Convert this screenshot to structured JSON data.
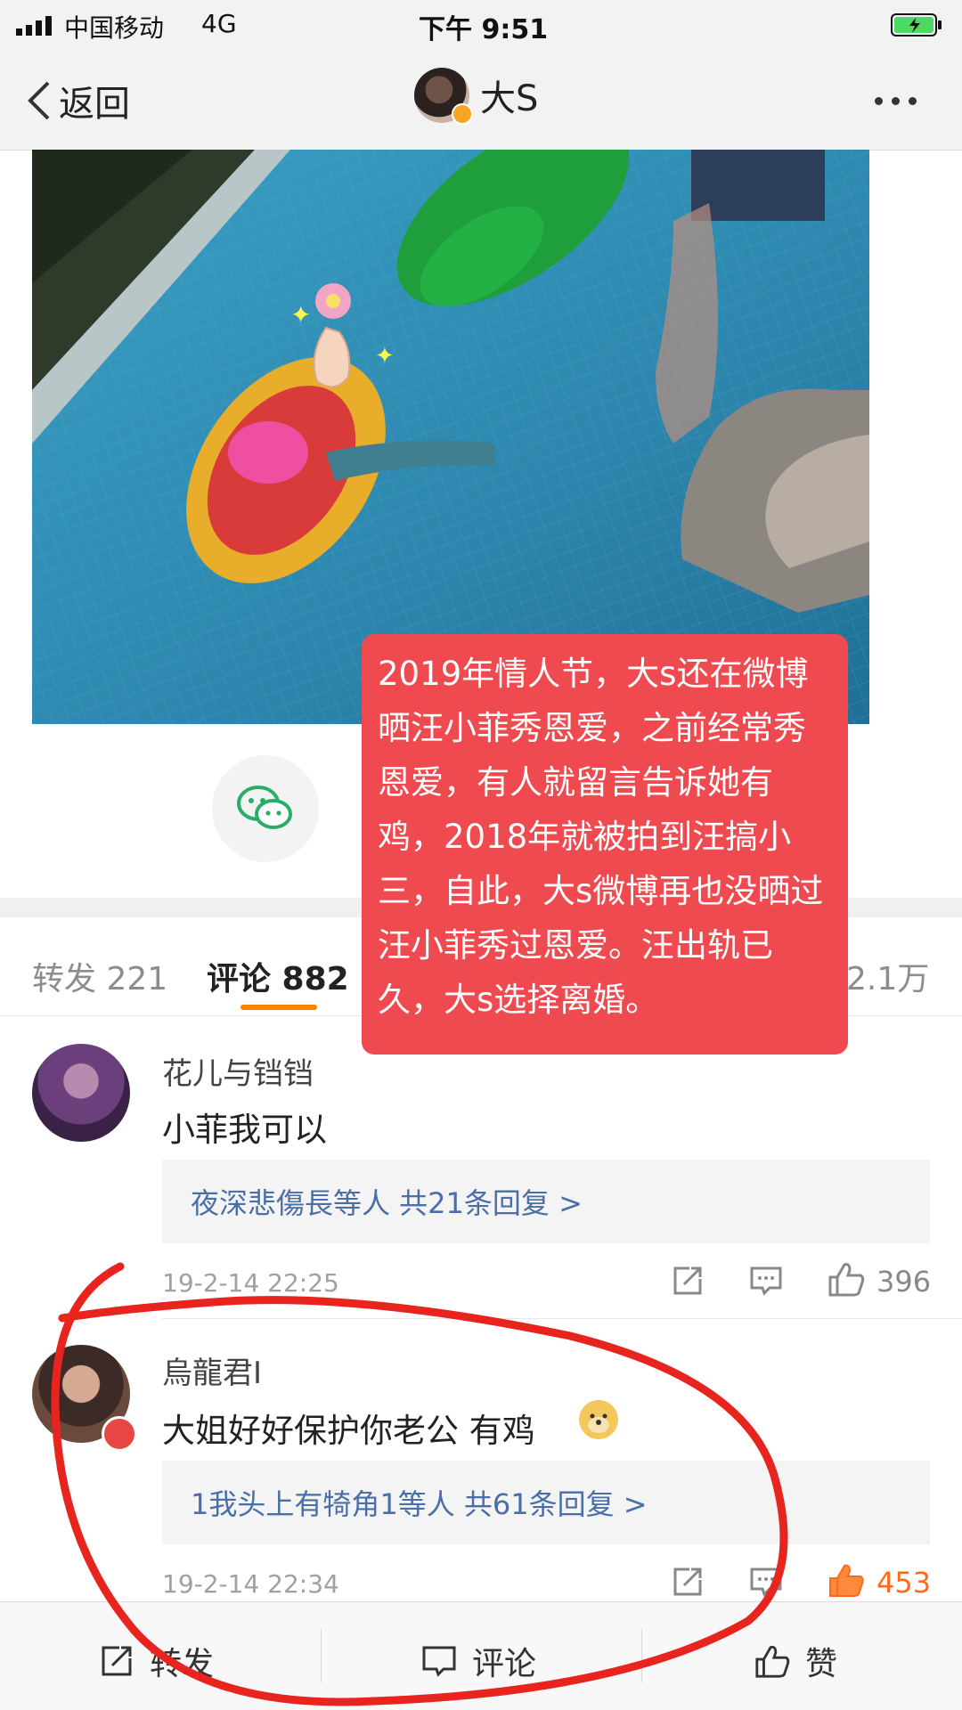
{
  "status_bar": {
    "carrier": "中国移动",
    "network": "4G",
    "time": "下午 9:51",
    "battery_color": "#4cd964"
  },
  "nav": {
    "back_label": "返回",
    "username": "大S",
    "more_icon": "more-dots-icon"
  },
  "annotation": {
    "text": "2019年情人节，大s还在微博晒汪小菲秀恩爱，之前经常秀恩爱，有人就留言告诉她有鸡，2018年就被拍到汪搞小三，自此，大s微博再也没晒过汪小菲秀过恩爱。汪出轨已久，大s选择离婚。",
    "background": "#ef4a4f"
  },
  "tabs": [
    {
      "label": "转发 221",
      "active": false
    },
    {
      "label": "评论 882",
      "active": true
    },
    {
      "label": "2.1万",
      "active": false
    }
  ],
  "accent": "#ff8200",
  "comments": [
    {
      "name": "花儿与铛铛",
      "text": "小菲我可以",
      "replies": "夜深悲傷長等人  共21条回复 >",
      "time": "19-2-14 22:25",
      "likes": "396"
    },
    {
      "name": "烏龍君I",
      "text": "大姐好好保护你老公 有鸡",
      "replies": "1我头上有犄角1等人  共61条回复 >",
      "time": "19-2-14 22:34",
      "likes": "453"
    }
  ],
  "bottom_bar": {
    "repost": "转发",
    "comment": "评论",
    "like": "赞"
  }
}
